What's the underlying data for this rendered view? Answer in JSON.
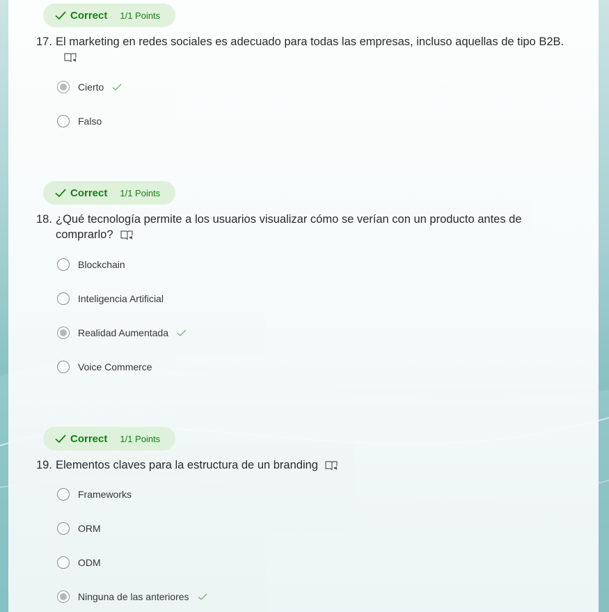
{
  "colors": {
    "correct_text": "#107c10",
    "correct_bg": "#e2f3dc",
    "accent_check": "#6bb86b"
  },
  "icons": {
    "badge_check": "checkmark-icon",
    "reader": "immersive-reader-icon",
    "answer_check": "correct-answer-checkmark-icon"
  },
  "questions": [
    {
      "status": "Correct",
      "points": "1/1 Points",
      "number": "17.",
      "text_line1": "El marketing en redes sociales es adecuado para todas las empresas, incluso aquellas de tipo B2B.",
      "text_line2": "",
      "options": [
        {
          "label": "Cierto",
          "selected": true,
          "correct": true
        },
        {
          "label": "Falso",
          "selected": false,
          "correct": false
        }
      ]
    },
    {
      "status": "Correct",
      "points": "1/1 Points",
      "number": "18.",
      "text_line1": "¿Qué tecnología permite a los usuarios visualizar cómo se verían con un producto antes de",
      "text_line2": "comprarlo?",
      "options": [
        {
          "label": "Blockchain",
          "selected": false,
          "correct": false
        },
        {
          "label": "Inteligencia Artificial",
          "selected": false,
          "correct": false
        },
        {
          "label": "Realidad Aumentada",
          "selected": true,
          "correct": true
        },
        {
          "label": "Voice Commerce",
          "selected": false,
          "correct": false
        }
      ]
    },
    {
      "status": "Correct",
      "points": "1/1 Points",
      "number": "19.",
      "text_line1": "Elementos claves para la estructura de un branding",
      "text_line2": "",
      "options": [
        {
          "label": "Frameworks",
          "selected": false,
          "correct": false
        },
        {
          "label": "ORM",
          "selected": false,
          "correct": false
        },
        {
          "label": "ODM",
          "selected": false,
          "correct": false
        },
        {
          "label": "Ninguna de las anteriores",
          "selected": true,
          "correct": true
        }
      ]
    }
  ]
}
